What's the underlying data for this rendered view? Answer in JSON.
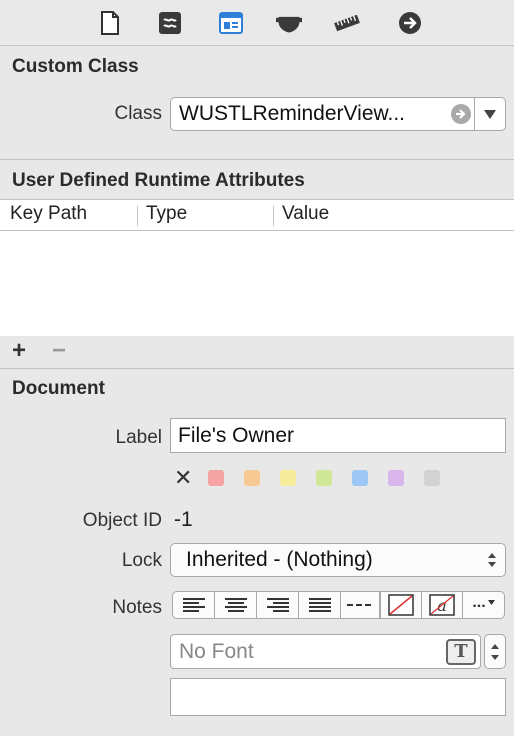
{
  "toolbar": {
    "icons": [
      "file-inspector-icon",
      "quick-help-icon",
      "identity-inspector-icon",
      "attributes-inspector-icon",
      "size-inspector-icon",
      "connections-inspector-icon"
    ],
    "active_index": 2,
    "accent": "#2f7fd8"
  },
  "custom_class": {
    "title": "Custom Class",
    "class_label": "Class",
    "class_value": "WUSTLReminderView..."
  },
  "runtime_attributes": {
    "title": "User Defined Runtime Attributes",
    "columns": [
      "Key Path",
      "Type",
      "Value"
    ],
    "add_label": "+",
    "remove_label": "−"
  },
  "document": {
    "title": "Document",
    "label_label": "Label",
    "label_value": "File's Owner",
    "clear_label": "✕",
    "swatches": [
      "#f5a3a3",
      "#f7c993",
      "#f7ec99",
      "#cfe796",
      "#9dc8f5",
      "#d9b7ec",
      "#d2d2d2"
    ],
    "object_id_label": "Object ID",
    "object_id_value": "-1",
    "lock_label": "Lock",
    "lock_value": "Inherited - (Nothing)",
    "notes_label": "Notes",
    "font_placeholder": "No Font",
    "font_button_label": "T",
    "more_label": "..."
  }
}
